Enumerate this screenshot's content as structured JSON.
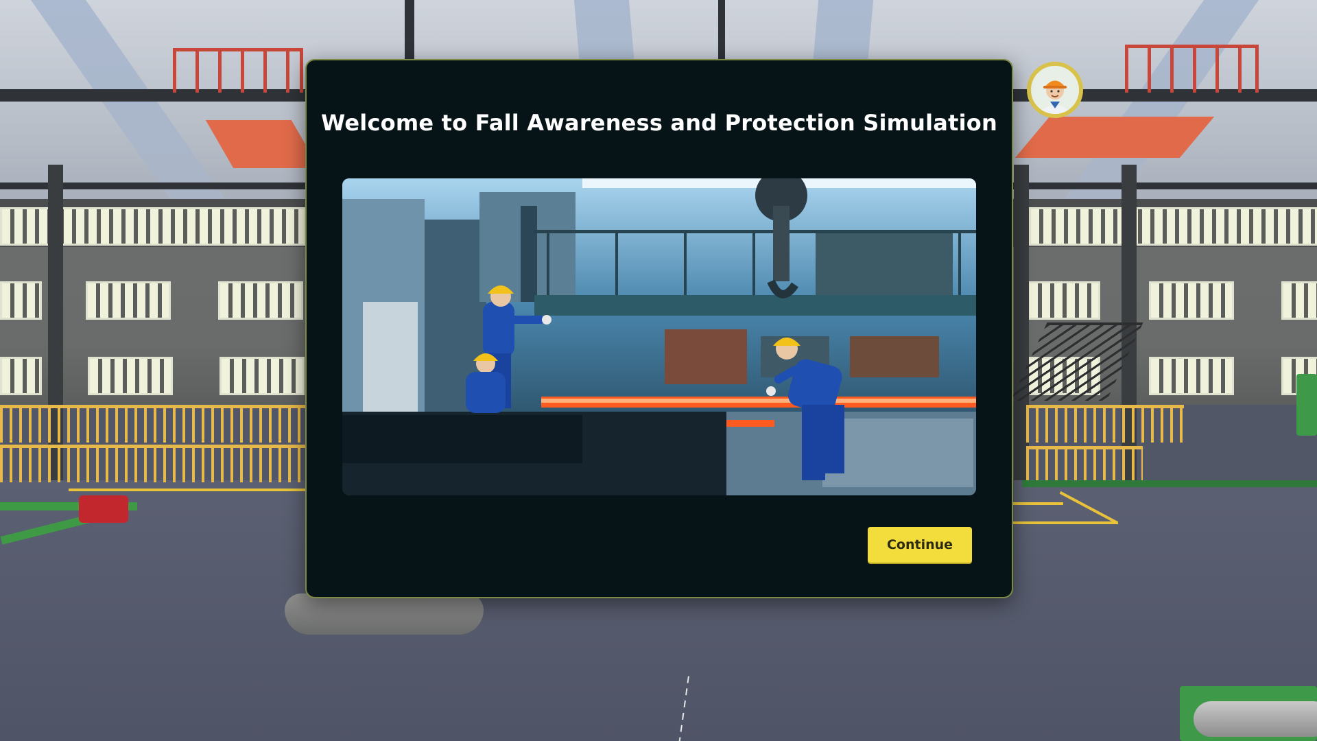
{
  "dialog": {
    "title": "Welcome to Fall Awareness and Protection Simulation",
    "image_alt": "Workers in blue coveralls and yellow hard hats at a steel mill",
    "continue_label": "Continue"
  },
  "avatar": {
    "icon": "worker-avatar-icon"
  },
  "colors": {
    "dialog_bg": "#061418",
    "dialog_border": "#7c8a43",
    "accent_button": "#f2dd3c",
    "hard_hat": "#f2c21a",
    "coverall": "#1f4fb0"
  }
}
